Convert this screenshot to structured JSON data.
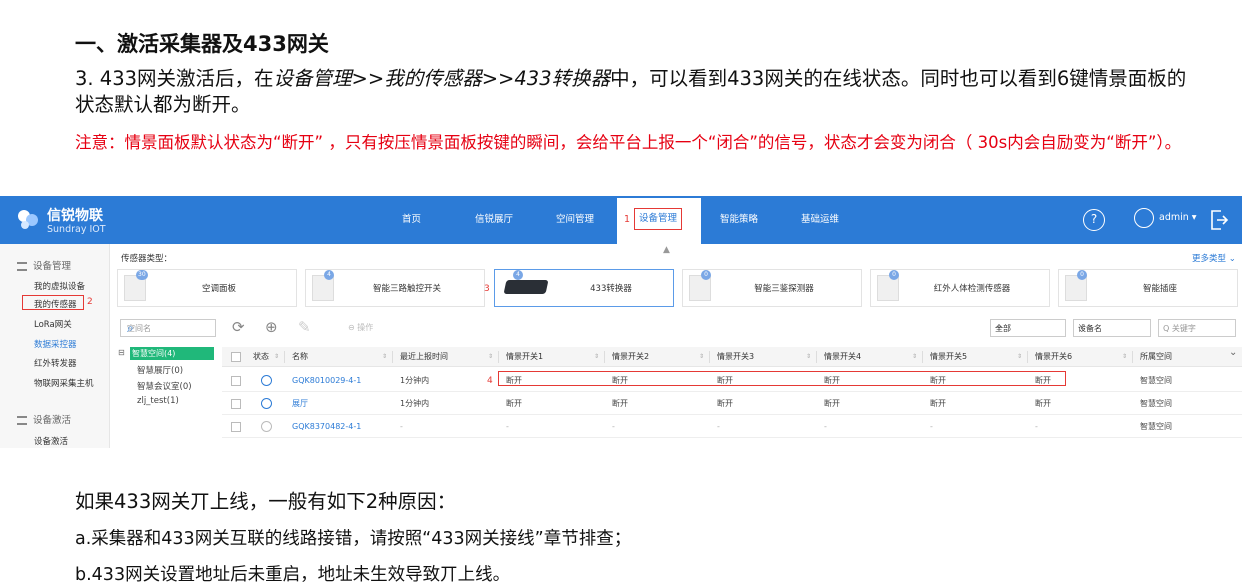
{
  "doc": {
    "title": "一、激活采集器及433网关",
    "p_before": "3. 433网关激活后，在",
    "p_italic": "设备管理>>我的传感器>>433转换器",
    "p_after": "中，可以看到433网关的在线状态。同时也可以看到6键情景面板的状态默认都为断开。",
    "note": "注意：情景面板默认状态为“断开”  ，只有按压情景面板按键的瞬间，会给平台上报一个“闭合”的信号，状态才会变为闭合（ 30s内会自励变为“断开”）。",
    "bottom_title": "如果433网关丌上线，一般有如下2种原因：",
    "line_a": "a.采集器和433网关互联的线路接错，请按照“433网关接线”章节排查；",
    "line_b": "b.433网关设置地址后未重启，地址未生效导致丌上线。"
  },
  "app": {
    "brand_cn": "信锐物联",
    "brand_en": "Sundray IOT",
    "nav": [
      "首页",
      "信锐展厅",
      "空间管理",
      "设备管理",
      "智能策略",
      "基础运维"
    ],
    "nav_active_marker": "1",
    "help_label": "?",
    "user": "admin ▾",
    "sidebar": {
      "group1": "设备管理",
      "items1": [
        "我的虚拟设备",
        "我的传感器",
        "LoRa网关",
        "数据采控器",
        "红外转发器",
        "物联网采集主机"
      ],
      "marker": "2",
      "group2": "设备激活",
      "items2": [
        "设备激活"
      ]
    },
    "sensor_type_label": "传感器类型：",
    "more_types": "更多类型 ⌄",
    "cards": [
      {
        "label": "空调面板",
        "badge": "30"
      },
      {
        "label": "智能三路触控开关",
        "badge": "4"
      },
      {
        "label": "433转换器",
        "badge": "4"
      },
      {
        "label": "智能三鉴探测器",
        "badge": "0"
      },
      {
        "label": "红外人体检测传感器",
        "badge": "0"
      },
      {
        "label": "智能插座",
        "badge": "0"
      }
    ],
    "card_marker": "3",
    "search_placeholder": "空间名",
    "op_label": "⊖ 操作",
    "filter_all": "全部",
    "filter_devname": "设备名",
    "keyword_placeholder": "Q 关键字",
    "tree": {
      "root": "智慧空间(4)",
      "children": [
        "智慧展厅(0)",
        "智慧会议室(0)",
        "zlj_test(1)"
      ]
    },
    "table": {
      "headers": [
        "状态",
        "名称",
        "最近上报时间",
        "情景开关1",
        "情景开关2",
        "情景开关3",
        "情景开关4",
        "情景开关5",
        "情景开关6",
        "所属空间"
      ],
      "row_marker": "4",
      "rows": [
        {
          "status": "on",
          "name": "GQK8010029-4-1",
          "time": "1分钟内",
          "s": [
            "断开",
            "断开",
            "断开",
            "断开",
            "断开",
            "断开"
          ],
          "space": "智慧空间"
        },
        {
          "status": "on",
          "name": "展厅",
          "time": "1分钟内",
          "s": [
            "断开",
            "断开",
            "断开",
            "断开",
            "断开",
            "断开"
          ],
          "space": "智慧空间"
        },
        {
          "status": "off",
          "name": "GQK8370482-4-1",
          "time": "-",
          "s": [
            "-",
            "-",
            "-",
            "-",
            "-",
            "-"
          ],
          "space": "智慧空间"
        }
      ]
    }
  }
}
